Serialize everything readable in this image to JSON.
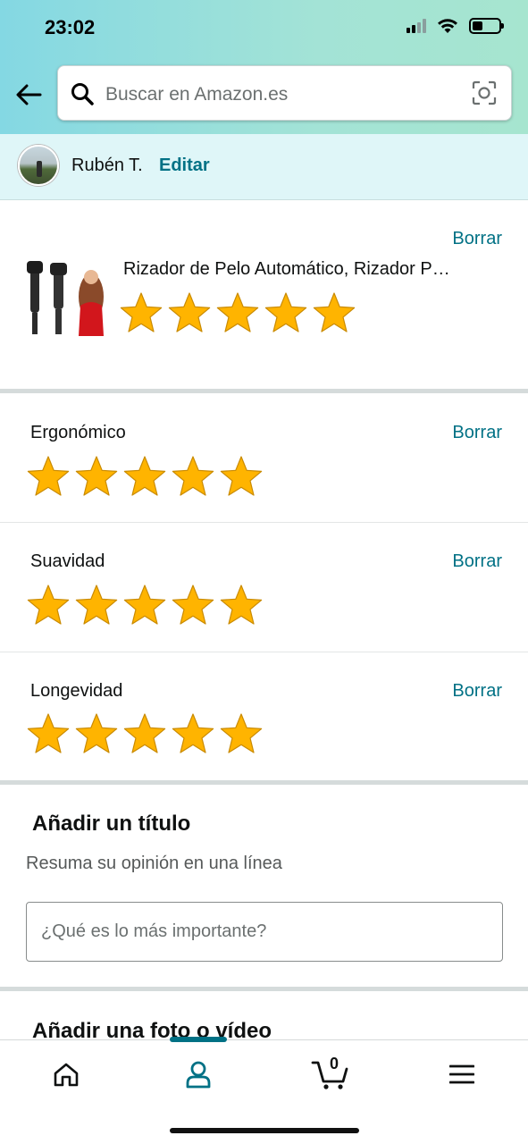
{
  "status_bar": {
    "time": "23:02"
  },
  "search": {
    "placeholder": "Buscar en Amazon.es"
  },
  "profile": {
    "name": "Rubén T.",
    "edit_label": "Editar"
  },
  "product": {
    "title": "Rizador de Pelo Automático, Rizador P…",
    "delete_label": "Borrar",
    "rating": 5,
    "max_rating": 5
  },
  "attributes": [
    {
      "label": "Ergonómico",
      "delete_label": "Borrar",
      "rating": 5
    },
    {
      "label": "Suavidad",
      "delete_label": "Borrar",
      "rating": 5
    },
    {
      "label": "Longevidad",
      "delete_label": "Borrar",
      "rating": 5
    }
  ],
  "title_section": {
    "heading": "Añadir un título",
    "subheading": "Resuma su opinión en una línea",
    "input_placeholder": "¿Qué es lo más importante?",
    "input_value": ""
  },
  "photo_section": {
    "heading": "Añadir una foto o vídeo"
  },
  "bottom_nav": {
    "items": [
      "home-icon",
      "account-icon",
      "cart-icon",
      "menu-icon"
    ],
    "active": "account-icon",
    "cart_count": "0"
  },
  "colors": {
    "link": "#007185",
    "star": "#ffb400",
    "header_from": "#84d8e3",
    "header_to": "#a6e5cf"
  }
}
